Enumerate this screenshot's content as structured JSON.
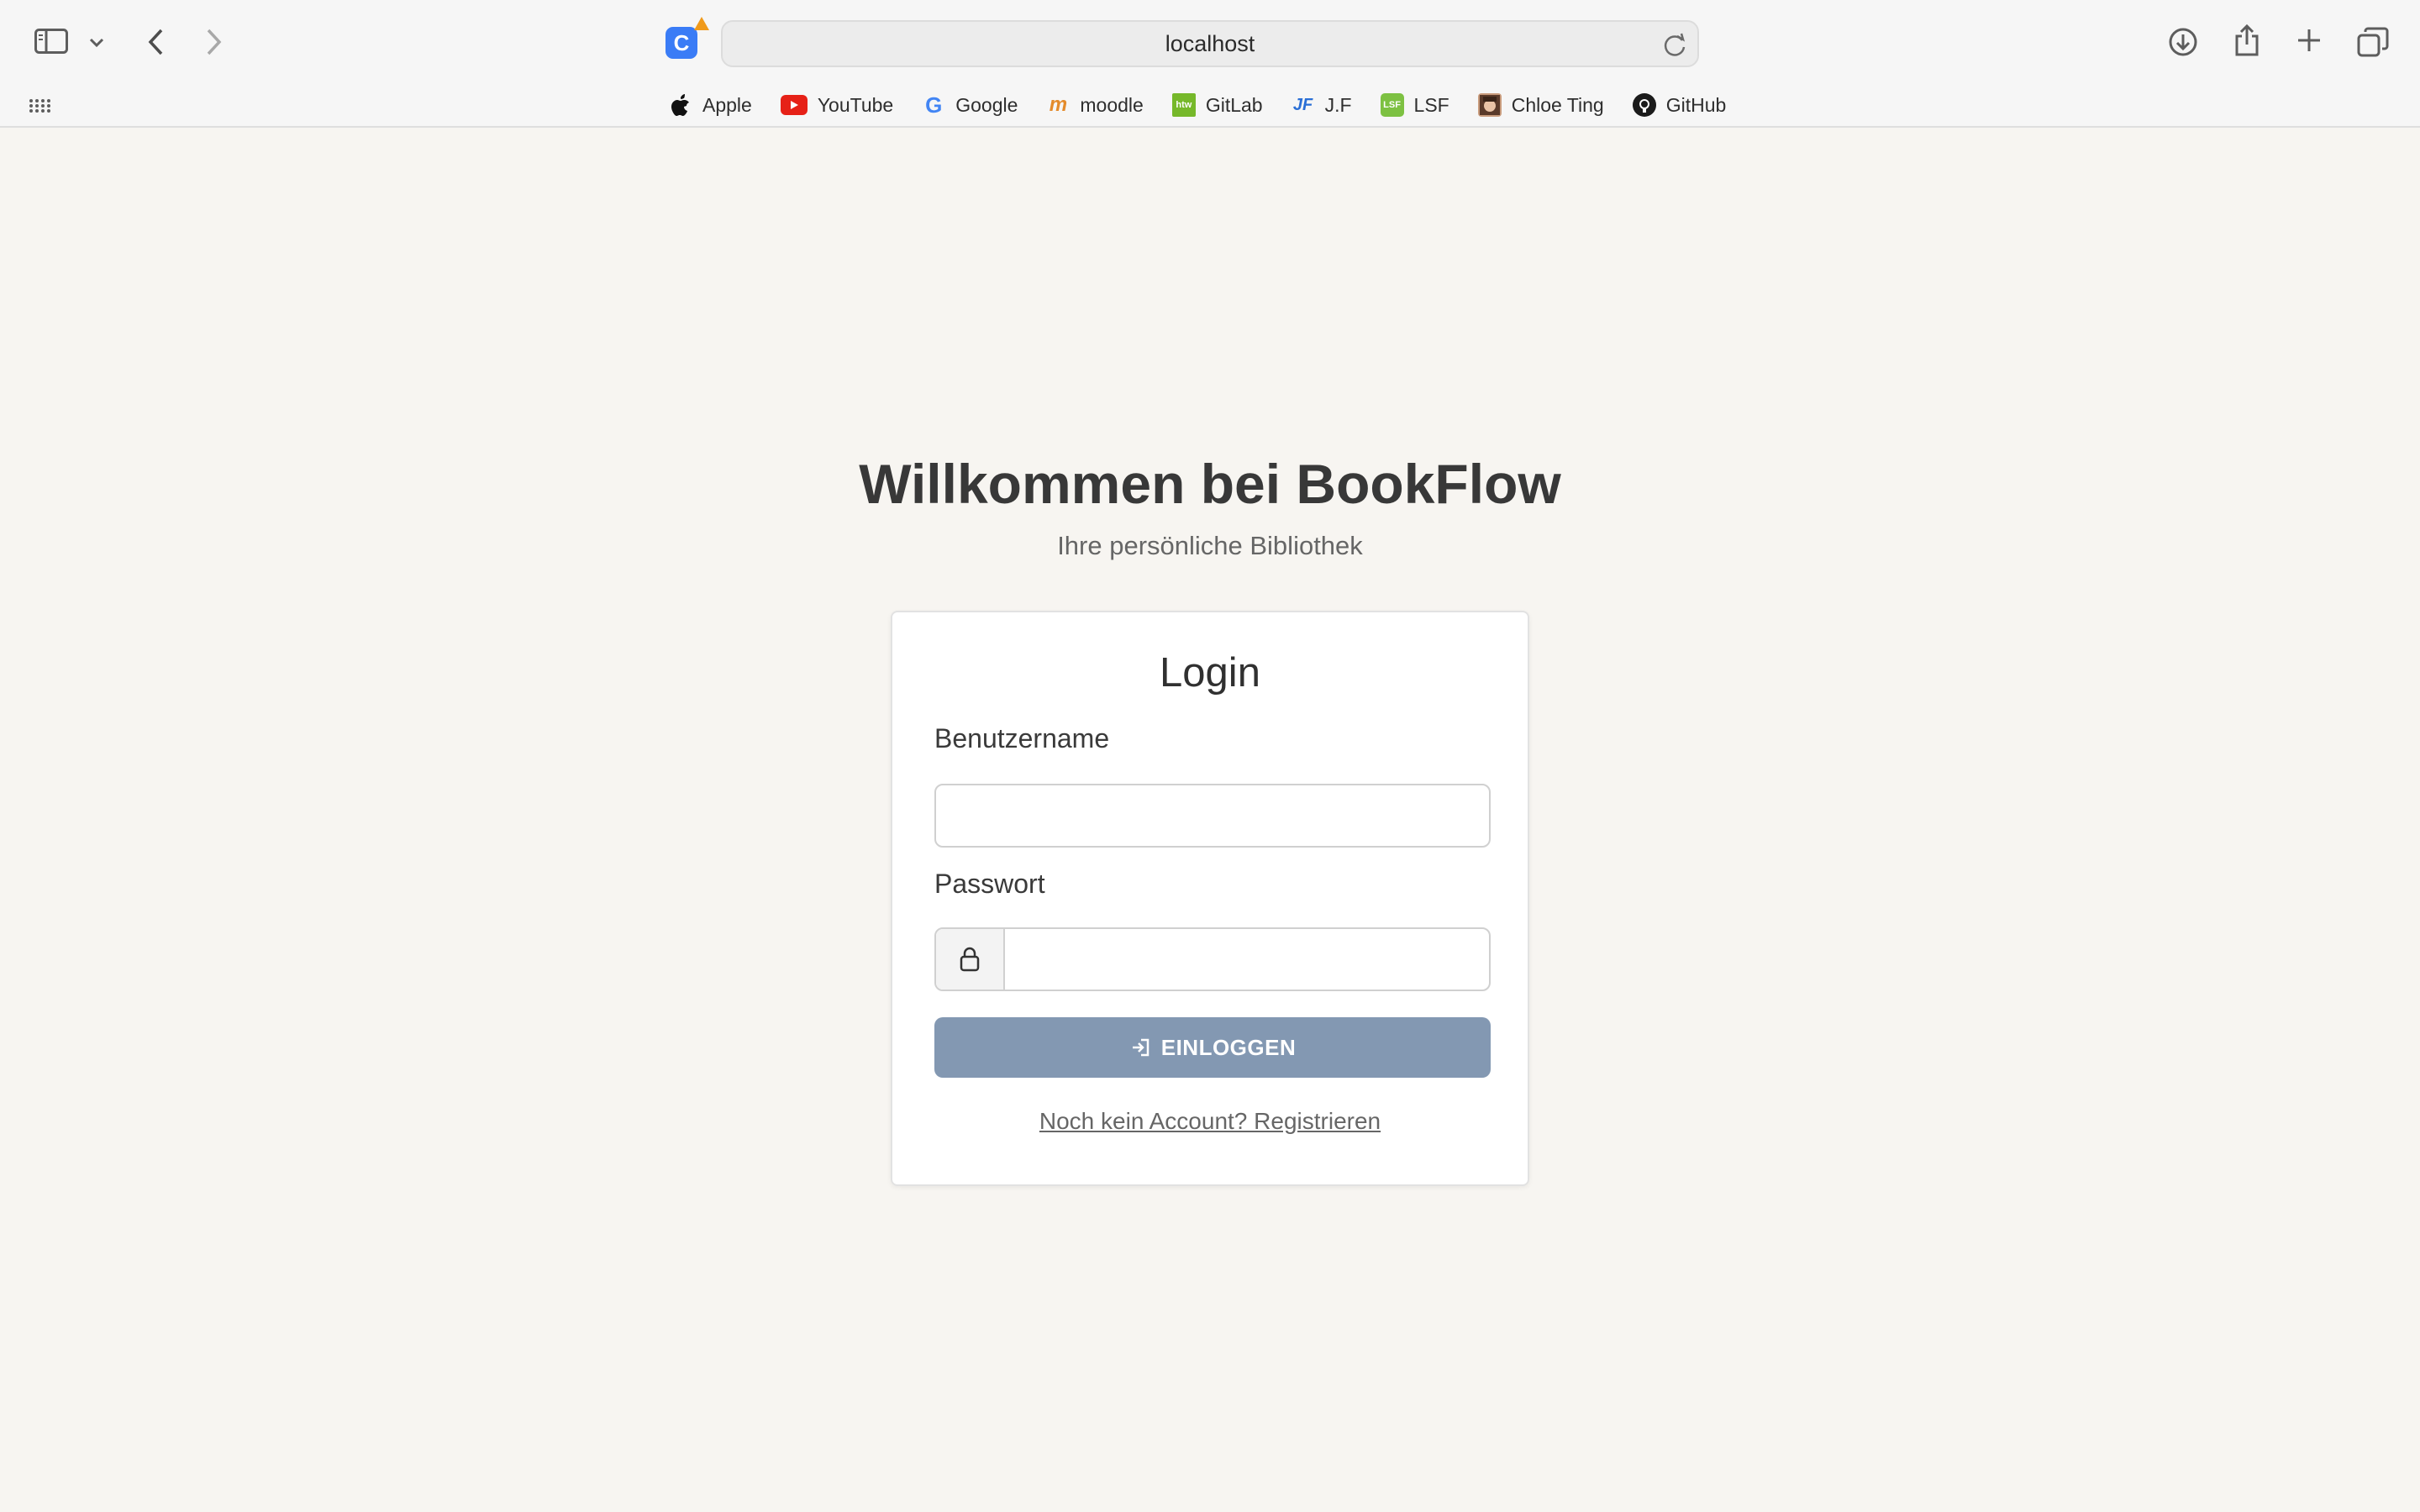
{
  "browser": {
    "url": "localhost",
    "extension_icon": "C",
    "bookmarks": [
      {
        "label": "Apple",
        "icon": "apple-icon"
      },
      {
        "label": "YouTube",
        "icon": "youtube-icon"
      },
      {
        "label": "Google",
        "icon": "google-icon"
      },
      {
        "label": "moodle",
        "icon": "moodle-icon"
      },
      {
        "label": "GitLab",
        "icon": "htw-icon",
        "icon_text": "htw"
      },
      {
        "label": "J.F",
        "icon": "jf-icon",
        "icon_text": "JF"
      },
      {
        "label": "LSF",
        "icon": "lsf-icon",
        "icon_text": "LSF"
      },
      {
        "label": "Chloe Ting",
        "icon": "chloe-ting-icon"
      },
      {
        "label": "GitHub",
        "icon": "github-icon"
      }
    ]
  },
  "page": {
    "heading": "Willkommen bei BookFlow",
    "subtitle": "Ihre persönliche Bibliothek"
  },
  "login": {
    "title": "Login",
    "username_label": "Benutzername",
    "username_value": "",
    "password_label": "Passwort",
    "password_value": "",
    "submit_label": "EINLOGGEN",
    "register_link": "Noch kein Account? Registrieren"
  },
  "colors": {
    "background": "#f7f5f1",
    "button": "#8398b2",
    "heading": "#383838"
  }
}
